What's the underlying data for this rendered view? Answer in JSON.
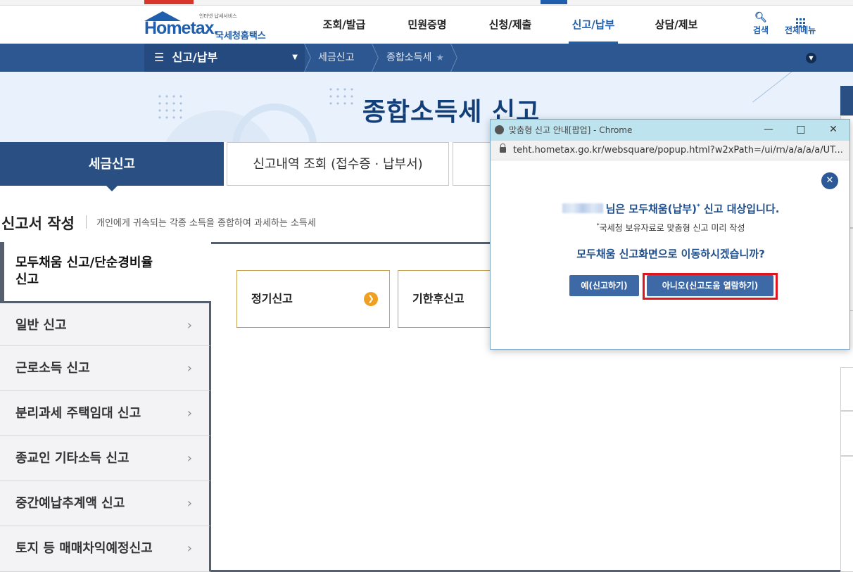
{
  "header": {
    "logo_text": "Hometax.",
    "logo_tagline": "인터넷 납세서비스",
    "logo_kname": "국세청홈택스",
    "gnb": [
      {
        "label": "조회/발급"
      },
      {
        "label": "민원증명"
      },
      {
        "label": "신청/제출"
      },
      {
        "label": "신고/납부"
      },
      {
        "label": "상담/제보"
      }
    ],
    "search_label": "검색",
    "allmenu_label": "전체메뉴"
  },
  "navbar": {
    "menu_label": "신고/납부",
    "crumb1": "세금신고",
    "crumb2": "종합소득세"
  },
  "hero": {
    "title": "종합소득세 신고"
  },
  "tabs": [
    {
      "label": "세금신고"
    },
    {
      "label": "신고내역 조회 (접수증 · 납부서)"
    }
  ],
  "section": {
    "title": "신고서 작성",
    "desc": "개인에게 귀속되는 각종 소득을 종합하여 과세하는 소득세"
  },
  "leftmenu": {
    "active_line1": "모두채움 신고/단순경비율",
    "active_line2": "신고",
    "items": [
      {
        "label": "일반 신고"
      },
      {
        "label": "근로소득 신고"
      },
      {
        "label": "분리과세 주택임대 신고"
      },
      {
        "label": "종교인 기타소득 신고"
      },
      {
        "label": "중간예납추계액 신고"
      },
      {
        "label": "토지 등 매매차익예정신고"
      }
    ]
  },
  "cards": [
    {
      "label": "정기신고"
    },
    {
      "label": "기한후신고"
    }
  ],
  "popup": {
    "window_title": "맞춤형 신고 안내[팝업] - Chrome",
    "url": "teht.hometax.go.kr/websquare/popup.html?w2xPath=/ui/rn/a/a/a/a/UT...",
    "msg1": "님은 모두채움(납부)",
    "msg1_suffix": " 신고 대상입니다.",
    "msg2": "국세청 보유자료로 맞춤형 신고 미리 작성",
    "msg3": "모두채움 신고화면으로 이동하시겠습니까?",
    "btn_yes": "예(신고하기)",
    "btn_no": "아니오(신고도움 열람하기)"
  },
  "colors": {
    "brand": "#1f5fae",
    "nav": "#2d5790",
    "highlight": "#e0141e",
    "accent": "#f0a020"
  }
}
